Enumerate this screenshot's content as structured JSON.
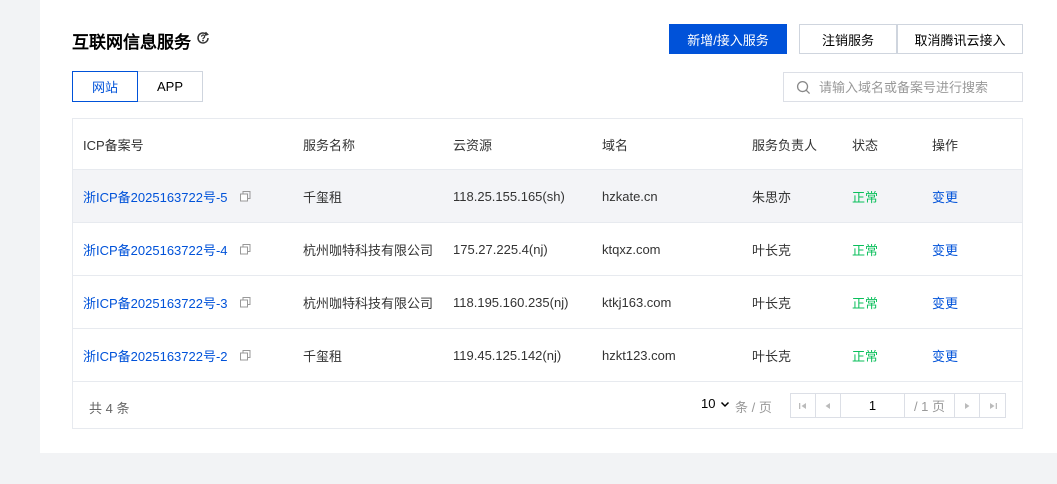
{
  "header": {
    "title": "互联网信息服务",
    "help_icon": "help-refresh-icon"
  },
  "actions": {
    "add": "新增/接入服务",
    "cancel_service": "注销服务",
    "cancel_access": "取消腾讯云接入"
  },
  "tabs": [
    {
      "label": "网站",
      "active": true
    },
    {
      "label": "APP",
      "active": false
    }
  ],
  "search": {
    "placeholder": "请输入域名或备案号进行搜索",
    "value": ""
  },
  "table": {
    "columns": [
      "ICP备案号",
      "服务名称",
      "云资源",
      "域名",
      "服务负责人",
      "状态",
      "操作"
    ],
    "rows": [
      {
        "icp": "浙ICP备2025163722号-5",
        "service": "千玺租",
        "resource": "118.25.155.165(sh)",
        "domain": "hzkate.cn",
        "owner": "朱思亦",
        "status": "正常",
        "action": "变更"
      },
      {
        "icp": "浙ICP备2025163722号-4",
        "service": "杭州咖特科技有限公司",
        "resource": "175.27.225.4(nj)",
        "domain": "ktqxz.com",
        "owner": "叶长克",
        "status": "正常",
        "action": "变更"
      },
      {
        "icp": "浙ICP备2025163722号-3",
        "service": "杭州咖特科技有限公司",
        "resource": "118.195.160.235(nj)",
        "domain": "ktkj163.com",
        "owner": "叶长克",
        "status": "正常",
        "action": "变更"
      },
      {
        "icp": "浙ICP备2025163722号-2",
        "service": "千玺租",
        "resource": "119.45.125.142(nj)",
        "domain": "hzkt123.com",
        "owner": "叶长克",
        "status": "正常",
        "action": "变更"
      }
    ]
  },
  "pagination": {
    "total": "共 4 条",
    "page_size": "10",
    "per_page_label": "条 / 页",
    "current_page": "1",
    "total_pages": "/ 1 页"
  },
  "colors": {
    "primary": "#0052d9",
    "status_ok": "#0abf5b"
  }
}
